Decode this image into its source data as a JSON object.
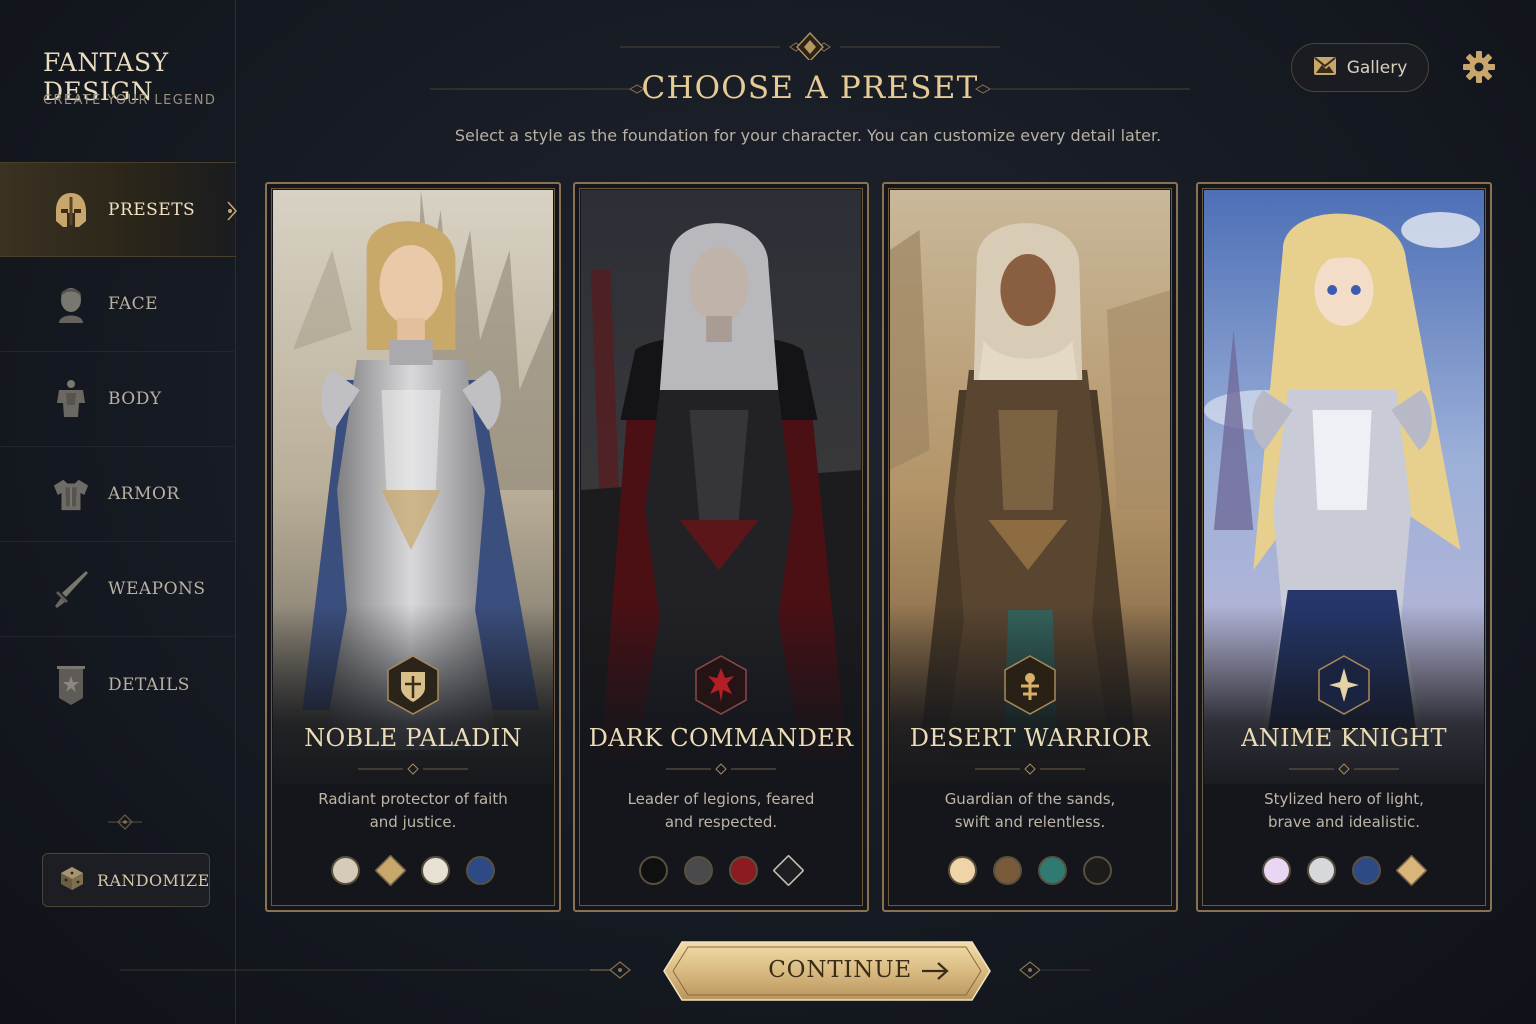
{
  "brand": {
    "title": "FANTASY DESIGN",
    "subtitle": "CREATE YOUR LEGEND"
  },
  "sidebar": {
    "items": [
      {
        "label": "PRESETS",
        "icon": "helmet-icon",
        "active": true
      },
      {
        "label": "FACE",
        "icon": "head-icon",
        "active": false
      },
      {
        "label": "BODY",
        "icon": "torso-icon",
        "active": false
      },
      {
        "label": "ARMOR",
        "icon": "armor-icon",
        "active": false
      },
      {
        "label": "WEAPONS",
        "icon": "sword-icon",
        "active": false
      },
      {
        "label": "DETAILS",
        "icon": "banner-icon",
        "active": false
      }
    ],
    "randomize_label": "RANDOMIZE"
  },
  "header": {
    "title": "CHOOSE A PRESET",
    "subtitle": "Select a style as the foundation for your character. You can customize every detail later.",
    "gallery_label": "Gallery"
  },
  "presets": [
    {
      "name": "NOBLE PALADIN",
      "desc_line1": "Radiant protector of faith",
      "desc_line2": "and justice.",
      "swatches": [
        "#d6cbb8",
        "#c9a66b",
        "#e7e1d4",
        "#2d4a86"
      ]
    },
    {
      "name": "DARK COMMANDER",
      "desc_line1": "Leader of legions, feared",
      "desc_line2": "and respected.",
      "swatches": [
        "#0f0f10",
        "#4a4a4c",
        "#8c1a1e",
        "#1d1f24"
      ]
    },
    {
      "name": "DESERT WARRIOR",
      "desc_line1": "Guardian of the sands,",
      "desc_line2": "swift and relentless.",
      "swatches": [
        "#efd4a8",
        "#7a5a3a",
        "#2f7a72",
        "#1e1c1a"
      ]
    },
    {
      "name": "ANIME KNIGHT",
      "desc_line1": "Stylized hero of light,",
      "desc_line2": "brave and idealistic.",
      "swatches": [
        "#e9d6f2",
        "#d7d8dc",
        "#2d4a86",
        "#d9b57a"
      ]
    }
  ],
  "footer": {
    "continue_label": "CONTINUE"
  },
  "colors": {
    "accent_gold": "#e6cc94",
    "panel": "#14161b",
    "border_gold": "#8a7250"
  }
}
